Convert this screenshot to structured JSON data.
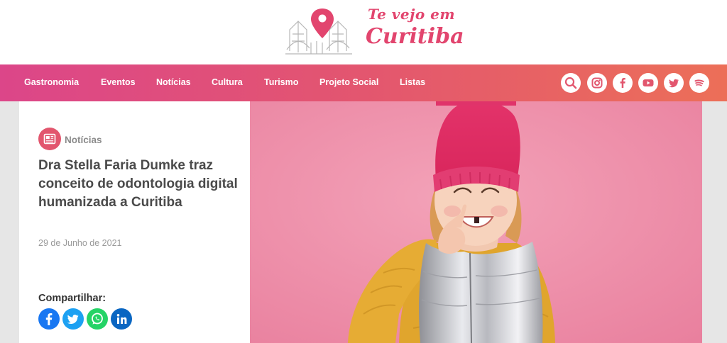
{
  "header": {
    "logo": {
      "line1": "Te vejo em",
      "line2": "Curitiba",
      "accent": "#e2456e"
    }
  },
  "nav": {
    "items": [
      "Gastronomia",
      "Eventos",
      "Notícias",
      "Cultura",
      "Turismo",
      "Projeto Social",
      "Listas"
    ],
    "icons": [
      "search-icon",
      "instagram-icon",
      "facebook-icon",
      "youtube-icon",
      "twitter-icon",
      "spotify-icon"
    ],
    "gradient": [
      "#dc4689",
      "#ec6f58"
    ],
    "icon_color": "#e2566e"
  },
  "article": {
    "category": "Notícias",
    "category_icon": "newspaper-icon",
    "title": "Dra Stella Faria Dumke traz conceito de odontologia digital humanizada a Curitiba",
    "date": "29 de Junho de 2021",
    "share": {
      "label": "Compartilhar:",
      "buttons": [
        {
          "icon": "facebook-icon",
          "color": "#1877f2"
        },
        {
          "icon": "twitter-icon",
          "color": "#1da1f2"
        },
        {
          "icon": "whatsapp-icon",
          "color": "#25d366"
        },
        {
          "icon": "linkedin-icon",
          "color": "#0a66c2"
        }
      ]
    },
    "hero_image": "smiling-girl-pink-hat-photo"
  }
}
